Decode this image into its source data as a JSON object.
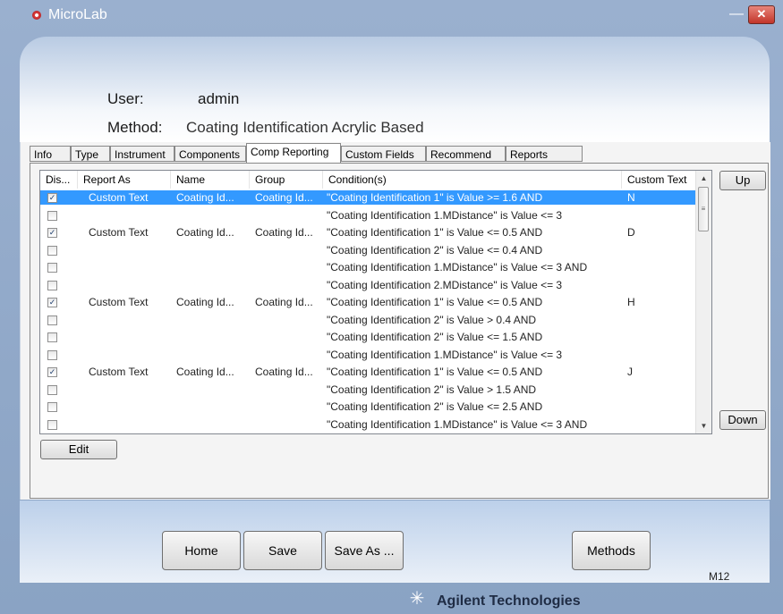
{
  "window": {
    "title": "MicroLab",
    "minimize": "—",
    "close": "✕"
  },
  "header": {
    "user_label": "User:",
    "user_value": "admin",
    "method_label": "Method:",
    "method_value": "Coating Identification Acrylic Based"
  },
  "tabs": [
    {
      "label": "Info"
    },
    {
      "label": "Type"
    },
    {
      "label": "Instrument"
    },
    {
      "label": "Components"
    },
    {
      "label": "Comp Reporting",
      "active": true
    },
    {
      "label": "Custom Fields"
    },
    {
      "label": "Recommend"
    },
    {
      "label": "Reports"
    }
  ],
  "grid": {
    "columns": [
      "Dis...",
      "Report As",
      "Name",
      "Group",
      "Condition(s)",
      "Custom Text"
    ],
    "rows": [
      {
        "checked": true,
        "report_as": "Custom Text",
        "name": "Coating Id...",
        "group": "Coating Id...",
        "condition": "\"Coating Identification 1\" is Value >= 1.6 AND",
        "custom_text": "N",
        "selected": true
      },
      {
        "checked": false,
        "report_as": "",
        "name": "",
        "group": "",
        "condition": "\"Coating Identification 1.MDistance\" is Value <= 3",
        "custom_text": ""
      },
      {
        "checked": true,
        "report_as": "Custom Text",
        "name": "Coating Id...",
        "group": "Coating Id...",
        "condition": "\"Coating Identification 1\" is Value <= 0.5 AND",
        "custom_text": "D"
      },
      {
        "checked": false,
        "report_as": "",
        "name": "",
        "group": "",
        "condition": "\"Coating Identification 2\" is Value <= 0.4 AND",
        "custom_text": ""
      },
      {
        "checked": false,
        "report_as": "",
        "name": "",
        "group": "",
        "condition": "\"Coating Identification 1.MDistance\" is Value <= 3 AND",
        "custom_text": ""
      },
      {
        "checked": false,
        "report_as": "",
        "name": "",
        "group": "",
        "condition": "\"Coating Identification 2.MDistance\" is Value <= 3",
        "custom_text": ""
      },
      {
        "checked": true,
        "report_as": "Custom Text",
        "name": "Coating Id...",
        "group": "Coating Id...",
        "condition": "\"Coating Identification 1\" is Value <= 0.5 AND",
        "custom_text": "H"
      },
      {
        "checked": false,
        "report_as": "",
        "name": "",
        "group": "",
        "condition": "\"Coating Identification 2\" is Value > 0.4 AND",
        "custom_text": ""
      },
      {
        "checked": false,
        "report_as": "",
        "name": "",
        "group": "",
        "condition": "\"Coating Identification 2\" is Value <= 1.5 AND",
        "custom_text": ""
      },
      {
        "checked": false,
        "report_as": "",
        "name": "",
        "group": "",
        "condition": "\"Coating Identification 1.MDistance\" is Value <= 3",
        "custom_text": ""
      },
      {
        "checked": true,
        "report_as": "Custom Text",
        "name": "Coating Id...",
        "group": "Coating Id...",
        "condition": "\"Coating Identification 1\" is Value <= 0.5 AND",
        "custom_text": "J"
      },
      {
        "checked": false,
        "report_as": "",
        "name": "",
        "group": "",
        "condition": "\"Coating Identification 2\" is Value > 1.5 AND",
        "custom_text": ""
      },
      {
        "checked": false,
        "report_as": "",
        "name": "",
        "group": "",
        "condition": "\"Coating Identification 2\" is Value <= 2.5 AND",
        "custom_text": ""
      },
      {
        "checked": false,
        "report_as": "",
        "name": "",
        "group": "",
        "condition": "\"Coating Identification 1.MDistance\" is Value <= 3 AND",
        "custom_text": ""
      }
    ]
  },
  "buttons": {
    "up": "Up",
    "down": "Down",
    "edit": "Edit",
    "home": "Home",
    "save": "Save",
    "save_as": "Save As ...",
    "methods": "Methods"
  },
  "screen_code": "M12",
  "brand": "Agilent Technologies"
}
